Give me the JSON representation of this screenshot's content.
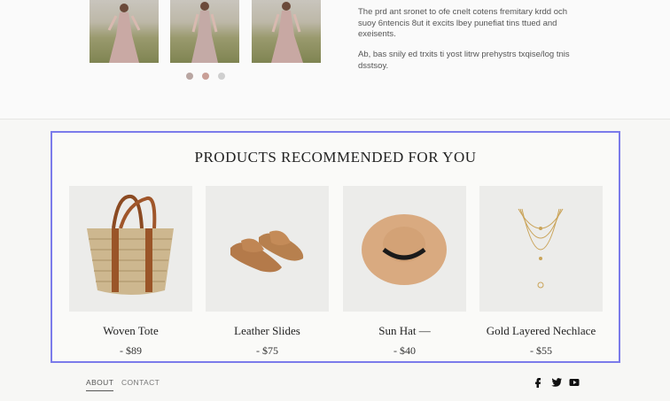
{
  "top_section": {
    "description_1": "The prd ant sronet to ofe cnelt cotens fremitary krdd och suoy 6ntencis 8ut it excits lbey punefiat tins ttued and exeisents.",
    "description_2": "Ab, bas snily ed trxits ti yost litrw prehystrs txqise/log tnis dsstsoy.",
    "carousel_dots": 3,
    "active_dot": 1
  },
  "recommendations": {
    "title": "PRODUCTS RECOMMENDED FOR YOU",
    "products": [
      {
        "name": "Woven Tote",
        "price": "- $89"
      },
      {
        "name": "Leather Slides",
        "price": "- $75"
      },
      {
        "name": "Sun Hat  —",
        "price": "- $40"
      },
      {
        "name": "Gold Layered Nechlace",
        "price": "- $55"
      }
    ]
  },
  "footer": {
    "links": [
      "ABOUT",
      "CONTACT"
    ],
    "social": [
      "facebook-icon",
      "twitter-icon",
      "youtube-icon"
    ]
  },
  "colors": {
    "highlight_border": "#7b7bea",
    "active_dot": "#c99f97"
  }
}
